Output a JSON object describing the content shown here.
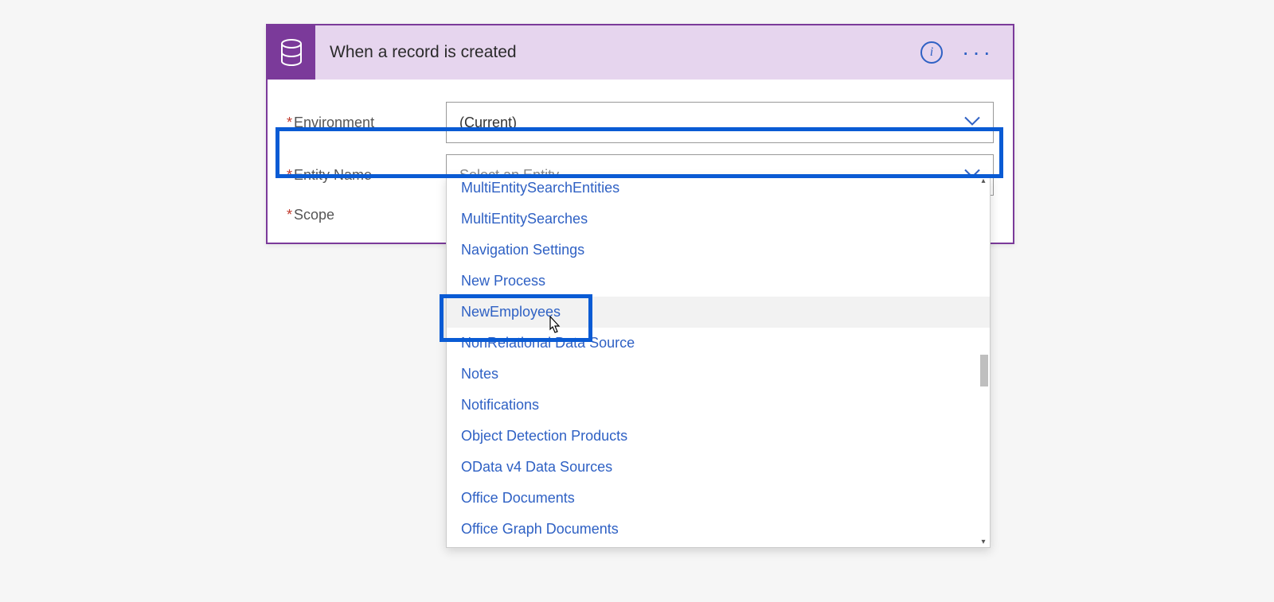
{
  "card": {
    "title": "When a record is created",
    "info_icon_label": "i",
    "ellipsis": "···"
  },
  "fields": {
    "environment": {
      "label": "Environment",
      "value": "(Current)"
    },
    "entity": {
      "label": "Entity Name",
      "placeholder": "Select an Entity."
    },
    "scope": {
      "label": "Scope"
    }
  },
  "dropdown": {
    "items": [
      "MultiEntitySearchEntities",
      "MultiEntitySearches",
      "Navigation Settings",
      "New Process",
      "NewEmployees",
      "NonRelational Data Source",
      "Notes",
      "Notifications",
      "Object Detection Products",
      "OData v4 Data Sources",
      "Office Documents",
      "Office Graph Documents"
    ],
    "hovered_index": 4
  }
}
